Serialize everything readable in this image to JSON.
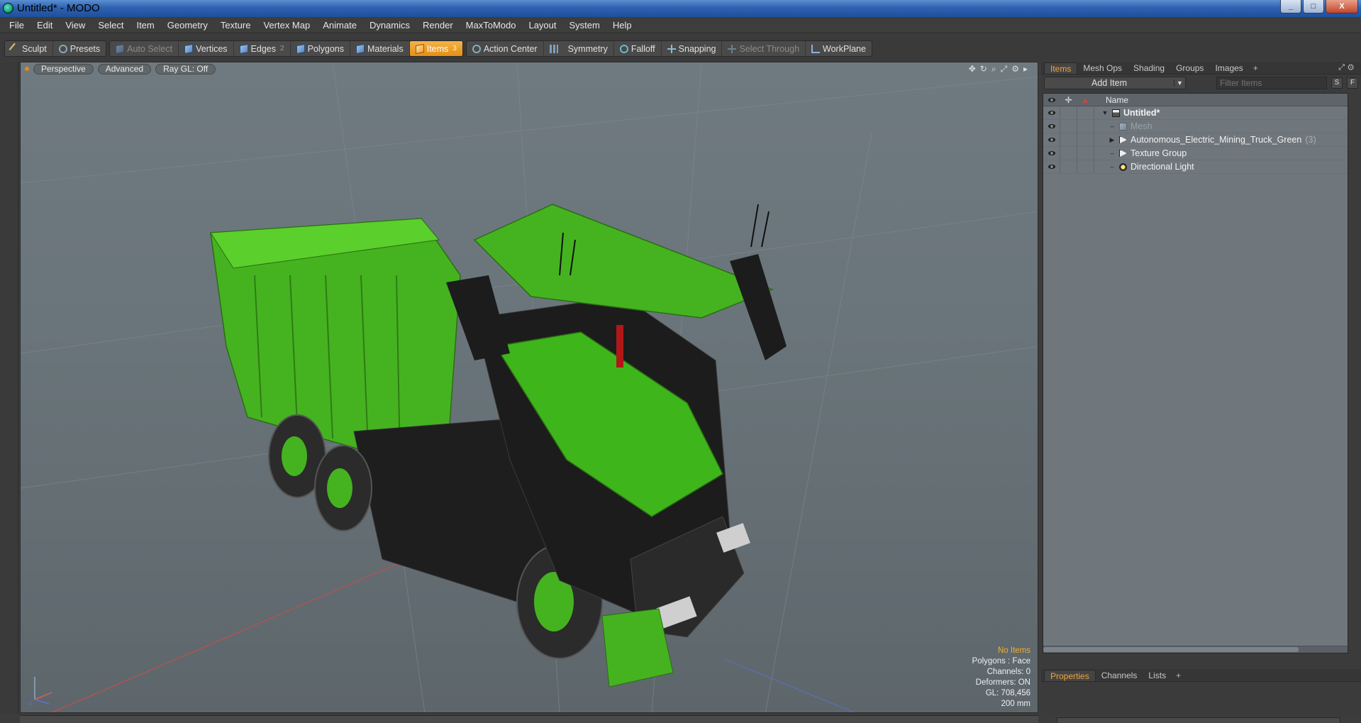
{
  "window": {
    "title": "Untitled* - MODO",
    "controls": [
      "_",
      "□",
      "X"
    ]
  },
  "menu": [
    "File",
    "Edit",
    "View",
    "Select",
    "Item",
    "Geometry",
    "Texture",
    "Vertex Map",
    "Animate",
    "Dynamics",
    "Render",
    "MaxToModo",
    "Layout",
    "System",
    "Help"
  ],
  "toolbar": {
    "sculpt": "Sculpt",
    "presets": "Presets",
    "auto_select": "Auto Select",
    "vertices": "Vertices",
    "edges": "Edges",
    "edges_badge": "2",
    "polygons": "Polygons",
    "materials": "Materials",
    "items": "Items",
    "items_badge": "3",
    "action_center": "Action Center",
    "symmetry": "Symmetry",
    "falloff": "Falloff",
    "snapping": "Snapping",
    "select_through": "Select Through",
    "workplane": "WorkPlane"
  },
  "viewport": {
    "view": "Perspective",
    "style": "Advanced",
    "raygl": "Ray GL: Off",
    "stats": {
      "selection": "No Items",
      "polygons": "Polygons : Face",
      "channels": "Channels: 0",
      "deformers": "Deformers: ON",
      "gl": "GL: 708,456",
      "unit": "200 mm"
    },
    "colors": {
      "background": "#6a757b",
      "truck_green": "#3fb51c",
      "truck_black": "#1c1c1c"
    }
  },
  "right_panel": {
    "tabs": [
      "Items",
      "Mesh Ops",
      "Shading",
      "Groups",
      "Images"
    ],
    "add_item": "Add Item",
    "filter_placeholder": "Filter Items",
    "btn_s": "S",
    "btn_f": "F",
    "name_header": "Name",
    "tree": {
      "scene": "Untitled*",
      "mesh": "Mesh",
      "truck": "Autonomous_Electric_Mining_Truck_Green",
      "truck_count": "(3)",
      "texture_group": "Texture Group",
      "light": "Directional Light"
    },
    "bottom_tabs": [
      "Properties",
      "Channels",
      "Lists"
    ]
  }
}
